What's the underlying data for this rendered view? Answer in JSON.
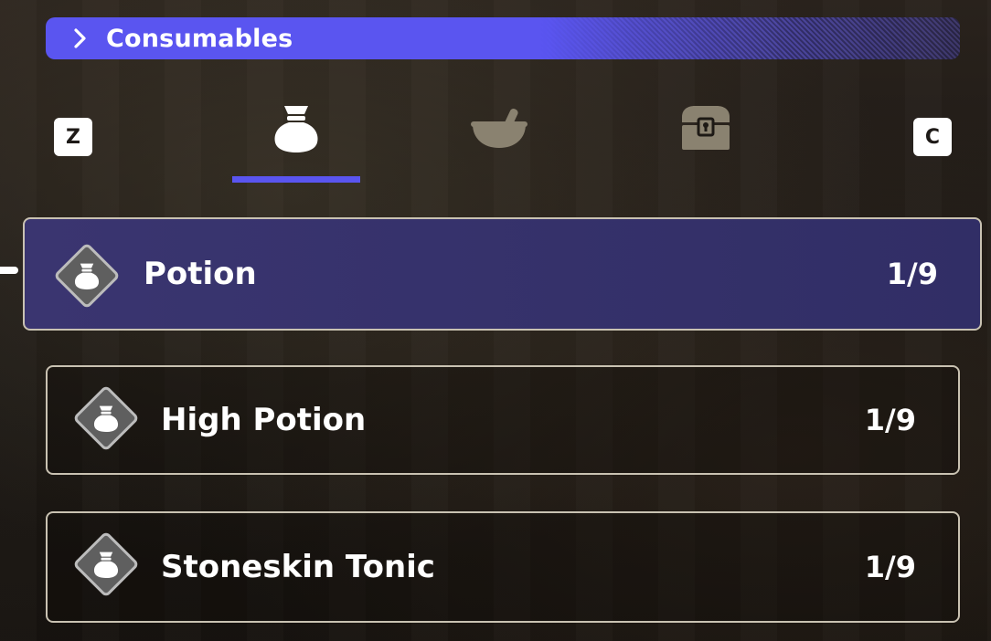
{
  "header": {
    "title": "Consumables",
    "icon": "chevron-right-icon",
    "accent_color": "#5a55f0"
  },
  "tabs": {
    "prev_key": "Z",
    "next_key": "C",
    "items": [
      {
        "icon": "item-bag-icon",
        "selected": true
      },
      {
        "icon": "mortar-pestle-icon",
        "selected": false
      },
      {
        "icon": "treasure-chest-icon",
        "selected": false
      }
    ]
  },
  "items": [
    {
      "name": "Potion",
      "count": "1/9",
      "icon": "item-bag-icon",
      "selected": true
    },
    {
      "name": "High Potion",
      "count": "1/9",
      "icon": "item-bag-icon",
      "selected": false
    },
    {
      "name": "Stoneskin Tonic",
      "count": "1/9",
      "icon": "item-bag-icon",
      "selected": false
    }
  ]
}
